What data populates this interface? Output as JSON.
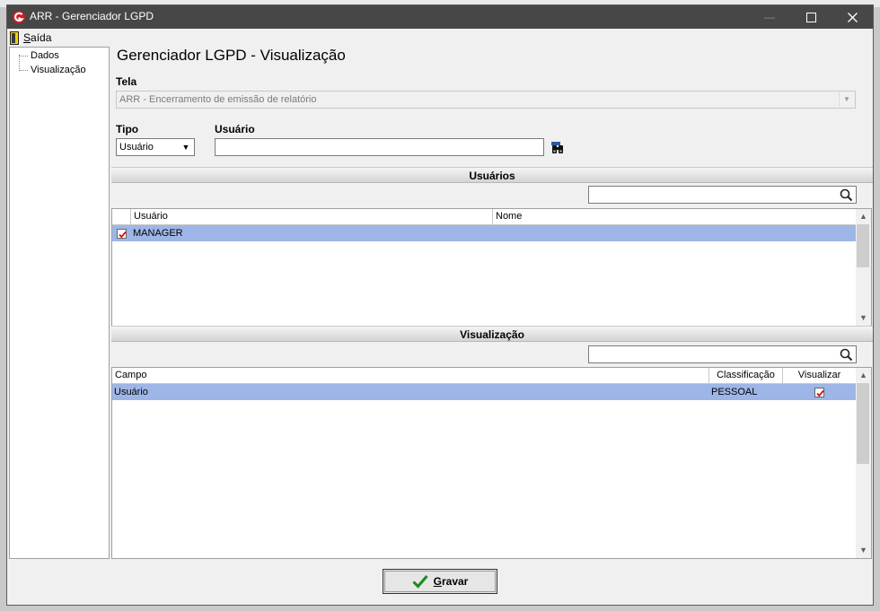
{
  "window": {
    "title": "ARR - Gerenciador LGPD",
    "minimize_glyph": "—",
    "maximize_glyph": "☐",
    "close_glyph": "✕"
  },
  "menu": {
    "exit_label_first": "S",
    "exit_label_rest": "aída",
    "exit_icon": "exit-door-icon"
  },
  "sidebar": {
    "items": [
      {
        "label": "Dados"
      },
      {
        "label": "Visualização"
      }
    ]
  },
  "page": {
    "heading": "Gerenciador LGPD - Visualização"
  },
  "form": {
    "tela_label": "Tela",
    "tela_value": "ARR - Encerramento de emissão de relatório",
    "tipo_label": "Tipo",
    "tipo_value": "Usuário",
    "usuario_label": "Usuário",
    "usuario_value": ""
  },
  "users_section": {
    "title": "Usuários",
    "search_value": "",
    "columns": [
      "Usuário",
      "Nome"
    ],
    "rows": [
      {
        "checked": true,
        "usuario": "MANAGER",
        "nome": ""
      }
    ]
  },
  "view_section": {
    "title": "Visualização",
    "search_value": "",
    "columns": [
      "Campo",
      "Classificação",
      "Visualizar"
    ],
    "rows": [
      {
        "campo": "Usuário",
        "classificacao": "PESSOAL",
        "visualizar": true
      }
    ]
  },
  "footer": {
    "save_label_first": "G",
    "save_label_rest": "ravar"
  },
  "colors": {
    "titlebar": "#474747",
    "selected_row": "#9eb6e7",
    "check_mark": "#d01010"
  }
}
